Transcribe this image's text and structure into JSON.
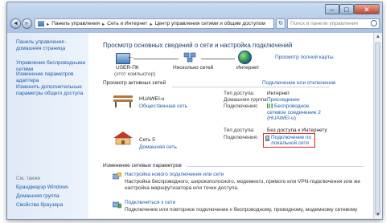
{
  "address": {
    "crumbs": [
      "Панель управления",
      "Сеть и Интернет",
      "Центр управления сетями и общим доступом"
    ],
    "search_placeholder": "Поиск в панели управления"
  },
  "window_controls": {
    "minimize": "–",
    "maximize": "□",
    "close": "✕"
  },
  "sidebar": {
    "home": "Панель управления - домашняя страница",
    "wireless": "Управление беспроводными сетями",
    "adapter": "Изменение параметров адаптера",
    "sharing": "Изменить дополнительные параметры общего доступа",
    "see_also": "См. также",
    "see_also_items": [
      "Брандмауэр Windows",
      "Домашняя группа",
      "Свойства браузера"
    ]
  },
  "main": {
    "title": "Просмотр основных сведений о сети и настройка подключений",
    "full_map": "Просмотр полной карты",
    "map": {
      "computer": "USER-ПК",
      "computer_sub": "(этот компьютер)",
      "network": "Несколько сетей",
      "internet": "Интернет"
    },
    "active_header": "Просмотр активных сетей",
    "active_link": "Подключение или отключение",
    "networks": [
      {
        "name": "HUAWEI-u",
        "type": "Общественная сеть",
        "access_label": "Тип доступа:",
        "access_value": "Интернет",
        "homegroup_label": "Домашняя группа:",
        "homegroup_value": "Присоединен",
        "connections_label": "Подключения:",
        "connections_value": "Беспроводное сетевое соединение 2 (HUAWEI-u)"
      },
      {
        "name": "Сеть 5",
        "type": "Домашняя сеть",
        "access_label": "Тип доступа:",
        "access_value": "Без доступа к Интернету",
        "connections_label": "Подключения:",
        "connections_value": "Подключение по локальной сети"
      }
    ],
    "change_header": "Изменение сетевых параметров",
    "changes": [
      {
        "title": "Настройка нового подключения или сети",
        "desc": "Настройка беспроводного, широкополосного, модемного, прямого или VPN-подключения или же настройка маршрутизатора или точки доступа."
      },
      {
        "title": "Подключиться к сети",
        "desc": "Подключение или повторное подключение к беспроводному, проводному, модемному сетевому"
      }
    ]
  },
  "colors": {
    "link": "#1d5ca8",
    "highlight_border": "#e0261b"
  }
}
